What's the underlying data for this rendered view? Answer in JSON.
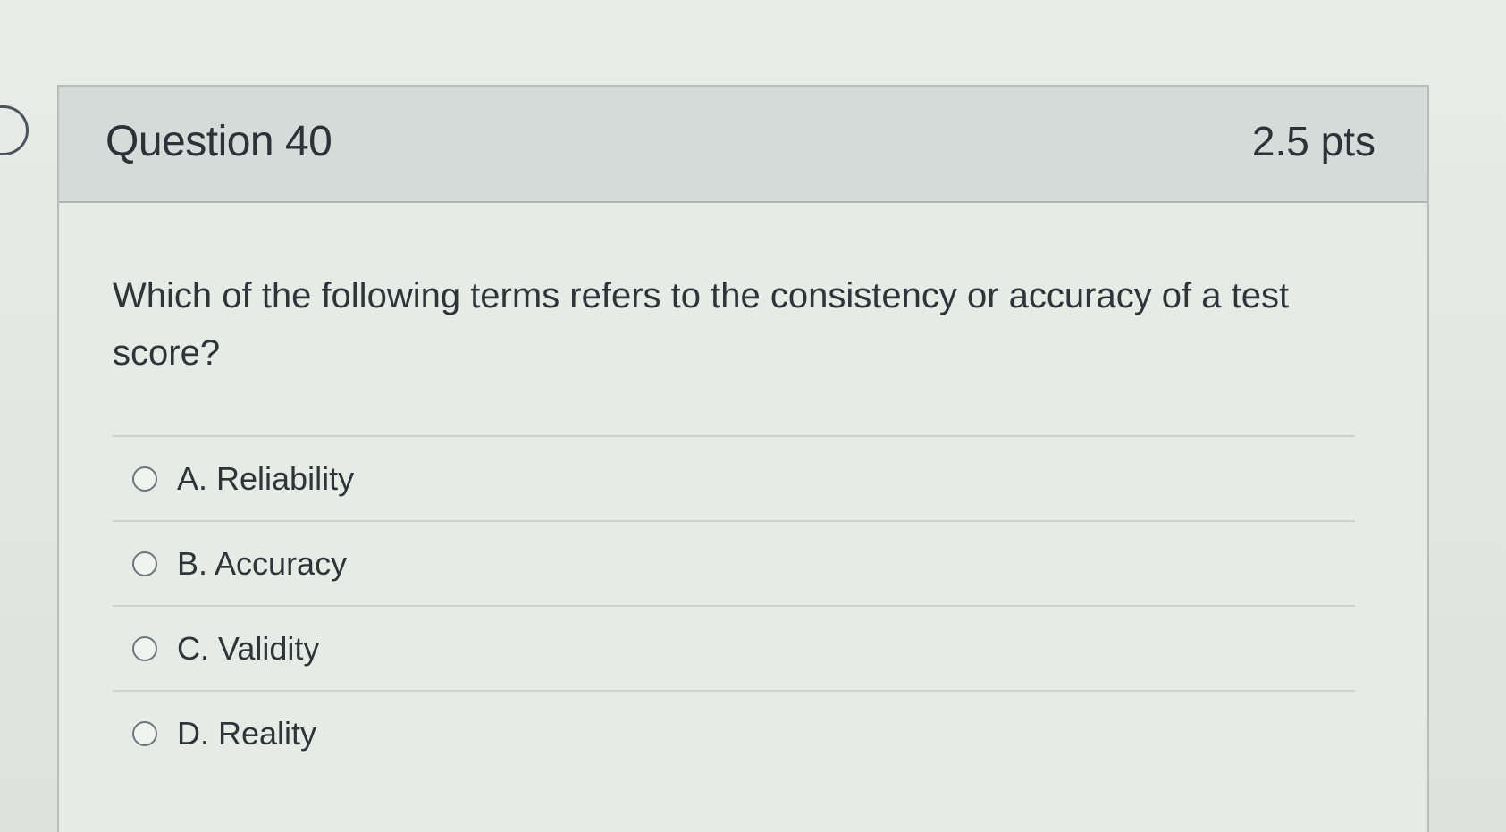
{
  "question": {
    "title": "Question 40",
    "points": "2.5 pts",
    "text": "Which of the following terms refers to the consistency or accuracy of a test score?",
    "answers": [
      {
        "label": "A. Reliability",
        "selected": false
      },
      {
        "label": "B. Accuracy",
        "selected": false
      },
      {
        "label": "C. Validity",
        "selected": false
      },
      {
        "label": "D. Reality",
        "selected": false
      }
    ]
  },
  "colors": {
    "header_bg": "#d5dbd8",
    "card_bg": "#e6ebe5",
    "text": "#2e353a",
    "border": "#b7bdb9"
  }
}
